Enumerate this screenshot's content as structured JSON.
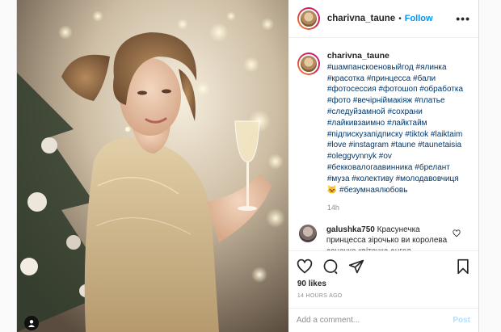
{
  "post": {
    "username": "charivna_taune",
    "follow_label": "Follow",
    "separator": "•",
    "more_label": "•••"
  },
  "caption": {
    "username": "charivna_taune",
    "text": "#шампанскоеновыйгод #ялинка #красотка #принцесса #бали #фотосессия #фотошоп #обработка #фото #вечірніймакіяж #платье #следуйзамной #сохрани #лайкивзаимно #лайктайм #підпискузапідписку #tiktok #laiktaim #love #instagram #taune #taunetaisia #oleggvynnyk #ov #бекковалогаавинника #брелант #муза #колективу #молодавовчиця 🐱 #безумнаялюбовь",
    "time": "14h"
  },
  "comment": {
    "username": "galushka750",
    "text": "Красунечка принцесса зірочько ви королева сонечко квіточка ангел принцесса пташечко обробоок"
  },
  "actions": {
    "like_icon": "heart-icon",
    "comment_icon": "comment-icon",
    "share_icon": "paper-plane-icon",
    "save_icon": "bookmark-icon"
  },
  "likes": "90 likes",
  "posted_ago": "14 HOURS AGO",
  "add_comment": {
    "placeholder": "Add a comment...",
    "post_label": "Post"
  },
  "colors": {
    "link": "#00376b",
    "follow": "#0095f6",
    "post_disabled": "#b2dffc",
    "muted": "#8e8e8e"
  }
}
